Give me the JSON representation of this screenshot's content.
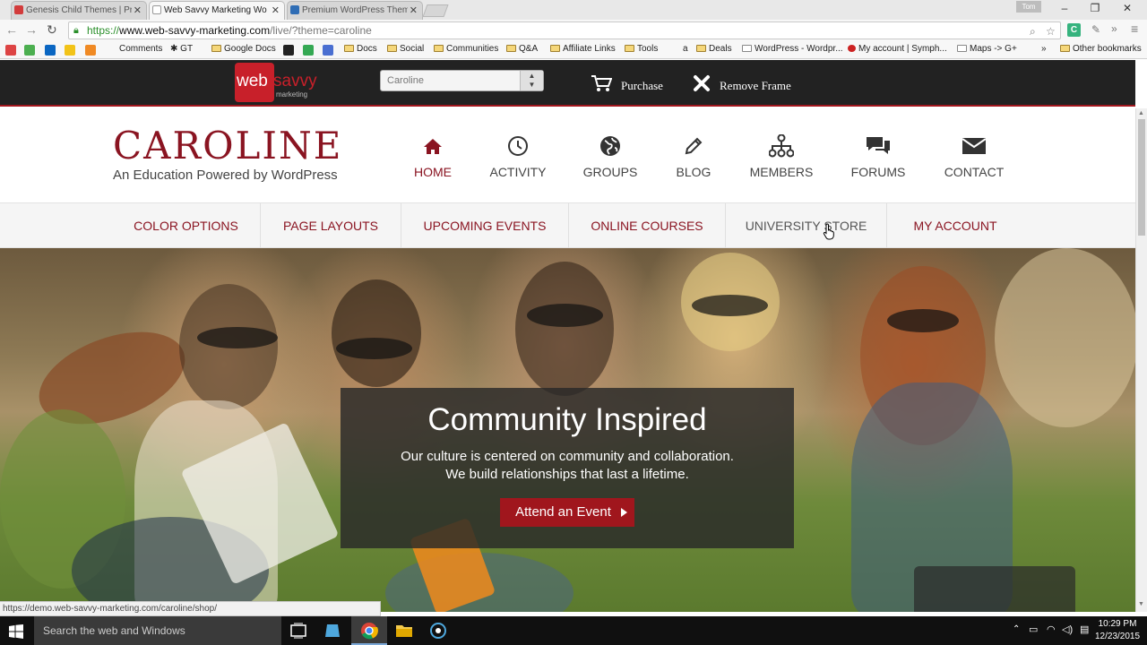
{
  "browser": {
    "tabs": [
      {
        "title": "Genesis Child Themes | Pr",
        "active": false,
        "color": "#d23b3b"
      },
      {
        "title": "Web Savvy Marketing Wo",
        "active": true,
        "color": "#ffffff"
      },
      {
        "title": "Premium WordPress Them",
        "active": false,
        "color": "#2f6db5"
      }
    ],
    "profile_label": "Tom",
    "url_scheme": "https://",
    "url_host": "www.web-savvy-marketing.com",
    "url_path": "/live/?theme=caroline",
    "extension_label": "C",
    "bookmarks": [
      "Comments",
      "GT",
      "Google Docs",
      "Docs",
      "Social",
      "Communities",
      "Q&A",
      "Affiliate Links",
      "Tools",
      "a",
      "Deals",
      "WordPress - Wordpr...",
      "My account | Symph...",
      "Maps -> G+",
      "»",
      "Other bookmarks"
    ]
  },
  "preview_bar": {
    "logo_web": "web",
    "logo_savvy": "savvy",
    "logo_marketing": "marketing",
    "theme_select_value": "Caroline",
    "purchase_label": "Purchase",
    "remove_frame_label": "Remove Frame"
  },
  "site": {
    "title": "CAROLINE",
    "description": "An Education Powered by WordPress",
    "main_nav": [
      {
        "label": "HOME",
        "icon": "home-icon",
        "active": true
      },
      {
        "label": "ACTIVITY",
        "icon": "clock-icon",
        "active": false
      },
      {
        "label": "GROUPS",
        "icon": "globe-icon",
        "active": false
      },
      {
        "label": "BLOG",
        "icon": "pencil-icon",
        "active": false
      },
      {
        "label": "MEMBERS",
        "icon": "sitemap-icon",
        "active": false
      },
      {
        "label": "FORUMS",
        "icon": "comments-icon",
        "active": false
      },
      {
        "label": "CONTACT",
        "icon": "envelope-icon",
        "active": false
      }
    ],
    "sub_nav": [
      "COLOR OPTIONS",
      "PAGE LAYOUTS",
      "UPCOMING EVENTS",
      "ONLINE COURSES",
      "UNIVERSITY STORE",
      "MY ACCOUNT"
    ],
    "hover_item": "UNIVERSITY STORE",
    "accent_color": "#8a1421",
    "button_color": "#a0161d"
  },
  "hero": {
    "title": "Community Inspired",
    "text_line1": "Our culture is centered on community and collaboration.",
    "text_line2": "We build relationships that last a lifetime.",
    "button_label": "Attend an Event"
  },
  "status": {
    "url": "https://demo.web-savvy-marketing.com/caroline/shop/"
  },
  "taskbar": {
    "search_placeholder": "Search the web and Windows",
    "time": "10:29 PM",
    "date": "12/23/2015"
  }
}
